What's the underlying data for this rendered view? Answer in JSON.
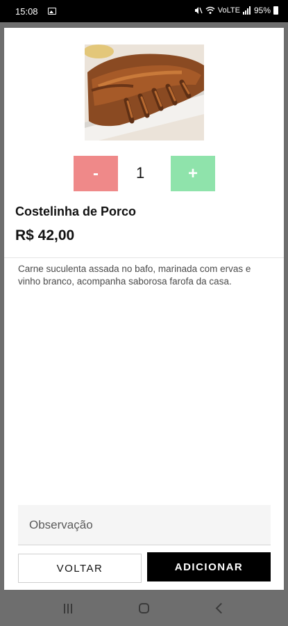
{
  "status_bar": {
    "time": "15:08",
    "network_label": "VoLTE",
    "battery": "95%"
  },
  "product": {
    "image_alt": "costelinha-de-porco-photo",
    "name": "Costelinha de Porco",
    "price": "R$ 42,00",
    "description": "Carne suculenta assada no bafo, marinada com ervas e vinho branco, acompanha saborosa farofa da casa."
  },
  "quantity": {
    "minus_label": "-",
    "value": "1",
    "plus_label": "+",
    "minus_color": "#ef8989",
    "plus_color": "#8fe3ab"
  },
  "observation": {
    "placeholder": "Observação",
    "value": ""
  },
  "actions": {
    "back_label": "VOLTAR",
    "add_label": "ADICIONAR"
  },
  "icons": [
    "image-icon",
    "mute-icon",
    "wifi-icon",
    "signal-icon",
    "battery-icon",
    "recents-icon",
    "home-icon",
    "back-icon"
  ]
}
